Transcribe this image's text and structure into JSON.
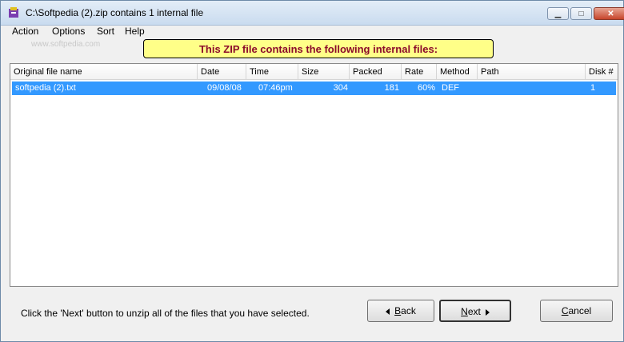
{
  "window": {
    "title": "C:\\Softpedia (2).zip contains 1 internal file",
    "min": "▁",
    "max": "□",
    "close": "✕"
  },
  "menu": [
    "Action",
    "Options",
    "Sort",
    "Help"
  ],
  "watermark": "www.softpedia.com",
  "banner": "This ZIP file contains the following internal files:",
  "columns": [
    "Original file name",
    "Date",
    "Time",
    "Size",
    "Packed",
    "Rate",
    "Method",
    "Path",
    "Disk #"
  ],
  "rows": [
    {
      "name": "softpedia (2).txt",
      "date": "09/08/08",
      "time": "07:46pm",
      "size": "304",
      "packed": "181",
      "rate": "60%",
      "method": "DEF",
      "path": "",
      "disk": "1"
    }
  ],
  "status": "Click the 'Next' button to unzip all of the files that you have selected.",
  "buttons": {
    "back": {
      "first": "B",
      "rest": "ack"
    },
    "next": {
      "first": "N",
      "rest": "ext"
    },
    "cancel": {
      "first": "C",
      "rest": "ancel"
    }
  },
  "colors": {
    "selection": "#3399ff",
    "banner_bg": "#ffff88",
    "banner_text": "#8b0a2a"
  },
  "icons": [
    "app-icon",
    "back-arrow-icon",
    "next-arrow-icon"
  ]
}
